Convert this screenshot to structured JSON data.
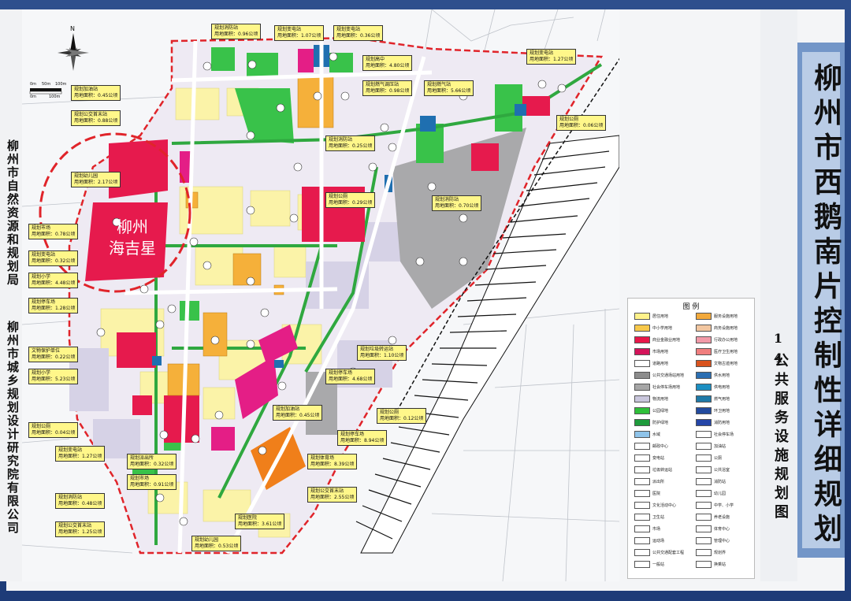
{
  "title": {
    "main": "柳州市西鹅南片控制性详细规划",
    "number": "14",
    "sub": "公共服务设施规划图"
  },
  "authors": {
    "bureau": "柳州市自然资源和规划局",
    "institute": "柳州市城乡规划设计研究院有限公司"
  },
  "compass": {
    "label": "N"
  },
  "scale": {
    "labels": [
      "0m",
      "50m",
      "100m",
      "0m",
      "100m"
    ]
  },
  "haijixing": "柳州\n海吉星",
  "callouts": [
    {
      "name": "规划消防站",
      "area": "用地面积：0.96公顷"
    },
    {
      "name": "规划变电站",
      "area": "用地面积：1.07公顷"
    },
    {
      "name": "规划变电站",
      "area": "用地面积：0.36公顷"
    },
    {
      "name": "规划高中",
      "area": "用地面积：4.80公顷"
    },
    {
      "name": "规划变电站",
      "area": "用地面积：1.27公顷"
    },
    {
      "name": "规划燃气调压站",
      "area": "用地面积：0.98公顷"
    },
    {
      "name": "规划燃气站",
      "area": "用地面积：5.66公顷"
    },
    {
      "name": "规划加油站",
      "area": "用地面积：0.45公顷"
    },
    {
      "name": "规划公交首末站",
      "area": "用地面积：0.88公顷"
    },
    {
      "name": "规划公厕",
      "area": "用地面积：0.06公顷"
    },
    {
      "name": "规划消防站",
      "area": "用地面积：0.25公顷"
    },
    {
      "name": "规划幼儿园",
      "area": "用地面积：2.17公顷"
    },
    {
      "name": "规划公厕",
      "area": "用地面积：0.29公顷"
    },
    {
      "name": "规划消防站",
      "area": "用地面积：0.70公顷"
    },
    {
      "name": "规划市场",
      "area": "用地面积：0.78公顷"
    },
    {
      "name": "规划变电站",
      "area": "用地面积：0.32公顷"
    },
    {
      "name": "规划小学",
      "area": "用地面积：4.48公顷"
    },
    {
      "name": "规划停车场",
      "area": "用地面积：1.28公顷"
    },
    {
      "name": "规划垃圾转运站",
      "area": "用地面积：1.10公顷"
    },
    {
      "name": "文物保护单位",
      "area": "用地面积：0.22公顷"
    },
    {
      "name": "规划停车场",
      "area": "用地面积：4.68公顷"
    },
    {
      "name": "规划小学",
      "area": "用地面积：5.23公顷"
    },
    {
      "name": "规划加油站",
      "area": "用地面积：0.45公顷"
    },
    {
      "name": "规划公厕",
      "area": "用地面积：0.12公顷"
    },
    {
      "name": "规划公厕",
      "area": "用地面积：0.04公顷"
    },
    {
      "name": "规划停车场",
      "area": "用地面积：8.94公顷"
    },
    {
      "name": "规划变电站",
      "area": "用地面积：1.27公顷"
    },
    {
      "name": "规划派出所",
      "area": "用地面积：0.32公顷"
    },
    {
      "name": "规划体育场",
      "area": "用地面积：8.39公顷"
    },
    {
      "name": "规划市场",
      "area": "用地面积：0.91公顷"
    },
    {
      "name": "规划消防站",
      "area": "用地面积：0.48公顷"
    },
    {
      "name": "规划公交首末站",
      "area": "用地面积：2.55公顷"
    },
    {
      "name": "规划公交首末站",
      "area": "用地面积：1.25公顷"
    },
    {
      "name": "规划医院",
      "area": "用地面积：3.61公顷"
    },
    {
      "name": "规划幼儿园",
      "area": "用地面积：0.53公顷"
    }
  ],
  "legend": {
    "title": "图 例",
    "items": [
      {
        "label": "居住用地",
        "color": "#fff28a"
      },
      {
        "label": "服务设施用地",
        "color": "#f2a93b"
      },
      {
        "label": "中小学用地",
        "color": "#f7c84a"
      },
      {
        "label": "商务设施用地",
        "color": "#f2c6a0"
      },
      {
        "label": "商业金融业用地",
        "color": "#e8174a"
      },
      {
        "label": "行政办公用地",
        "color": "#f29aa8"
      },
      {
        "label": "市场用地",
        "color": "#d4145a"
      },
      {
        "label": "医疗卫生用地",
        "color": "#f07e7e"
      },
      {
        "label": "道路用地",
        "color": "#ffffff"
      },
      {
        "label": "文物古迹用地",
        "color": "#d9531e"
      },
      {
        "label": "公共交通场站用地",
        "color": "#8c8c8c"
      },
      {
        "label": "供水用地",
        "color": "#2b6fb3"
      },
      {
        "label": "社会停车场用地",
        "color": "#a6a6a6"
      },
      {
        "label": "供电用地",
        "color": "#1c8fc2"
      },
      {
        "label": "物流用地",
        "color": "#c9c6dc"
      },
      {
        "label": "燃气用地",
        "color": "#1f7aa8"
      },
      {
        "label": "公园绿地",
        "color": "#2fbf3a"
      },
      {
        "label": "环卫用地",
        "color": "#234b9e"
      },
      {
        "label": "防护绿地",
        "color": "#1e9b3c"
      },
      {
        "label": "消防用地",
        "color": "#2546a8"
      },
      {
        "label": "水域",
        "color": "#8fc4ea"
      },
      {
        "label": "社会停车场",
        "color": "#ffffff"
      },
      {
        "label": "邮政中心",
        "color": "#ffffff"
      },
      {
        "label": "加油站",
        "color": "#ffffff"
      },
      {
        "label": "变电站",
        "color": "#ffffff"
      },
      {
        "label": "公厕",
        "color": "#ffffff"
      },
      {
        "label": "垃圾转运站",
        "color": "#ffffff"
      },
      {
        "label": "公共浴室",
        "color": "#ffffff"
      },
      {
        "label": "派出所",
        "color": "#ffffff"
      },
      {
        "label": "消防站",
        "color": "#ffffff"
      },
      {
        "label": "医院",
        "color": "#ffffff"
      },
      {
        "label": "幼儿园",
        "color": "#ffffff"
      },
      {
        "label": "文化活动中心",
        "color": "#ffffff"
      },
      {
        "label": "中学、小学",
        "color": "#ffffff"
      },
      {
        "label": "卫生站",
        "color": "#ffffff"
      },
      {
        "label": "养老设施",
        "color": "#ffffff"
      },
      {
        "label": "市场",
        "color": "#ffffff"
      },
      {
        "label": "体育中心",
        "color": "#ffffff"
      },
      {
        "label": "运动场",
        "color": "#ffffff"
      },
      {
        "label": "管理中心",
        "color": "#ffffff"
      },
      {
        "label": "公共交通配套工程",
        "color": "#ffffff"
      },
      {
        "label": "规划界",
        "color": "#ffffff"
      },
      {
        "label": "一般站",
        "color": "#ffffff"
      },
      {
        "label": "换乘站",
        "color": "#ffffff"
      }
    ]
  }
}
